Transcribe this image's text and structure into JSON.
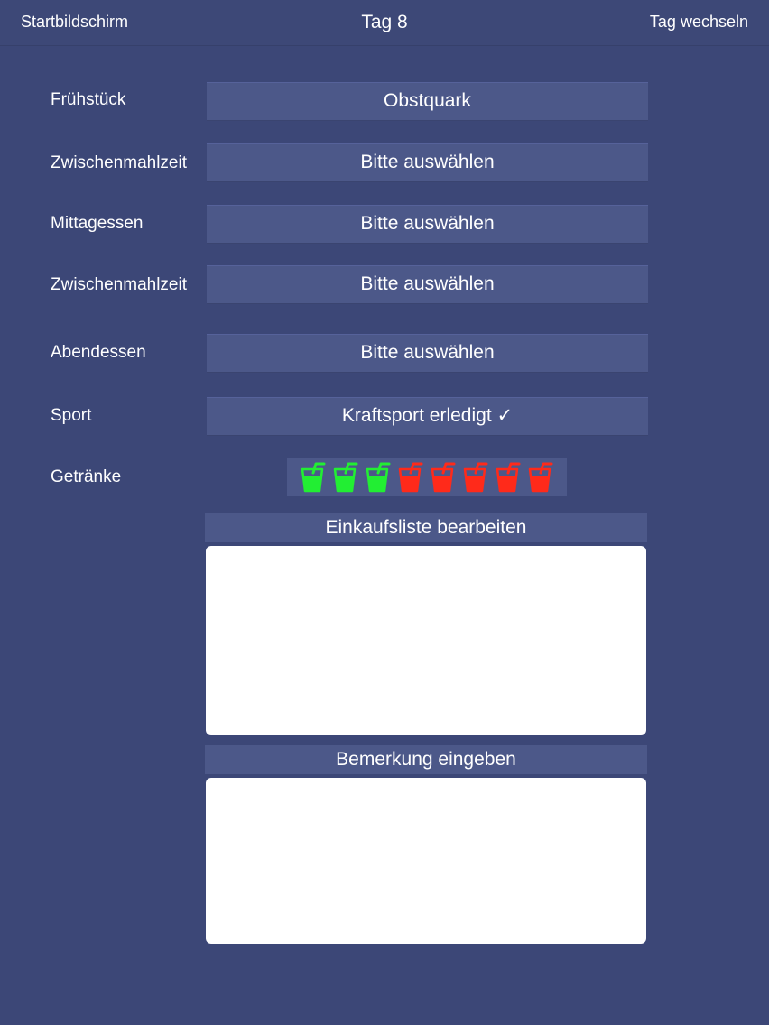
{
  "nav": {
    "left_label": "Startbildschirm",
    "title": "Tag 8",
    "right_label": "Tag wechseln"
  },
  "meals": [
    {
      "label": "Frühstück",
      "value": "Obstquark"
    },
    {
      "label": "Zwischenmahlzeit",
      "value": "Bitte auswählen"
    },
    {
      "label": "Mittagessen",
      "value": "Bitte auswählen"
    },
    {
      "label": "Zwischenmahlzeit",
      "value": "Bitte auswählen"
    },
    {
      "label": "Abendessen",
      "value": "Bitte auswählen"
    }
  ],
  "sport": {
    "label": "Sport",
    "value": "Kraftsport erledigt ✓"
  },
  "drinks": {
    "label": "Getränke",
    "total": 8,
    "completed": 3,
    "icon": "drink-glass-icon",
    "completed_color": "#22ee33",
    "remaining_color": "#ff2a1a"
  },
  "shopping_list": {
    "header": "Einkaufsliste bearbeiten",
    "value": ""
  },
  "notes": {
    "header": "Bemerkung eingeben",
    "value": ""
  },
  "colors": {
    "background": "#3c4777",
    "button": "#4c5889"
  }
}
